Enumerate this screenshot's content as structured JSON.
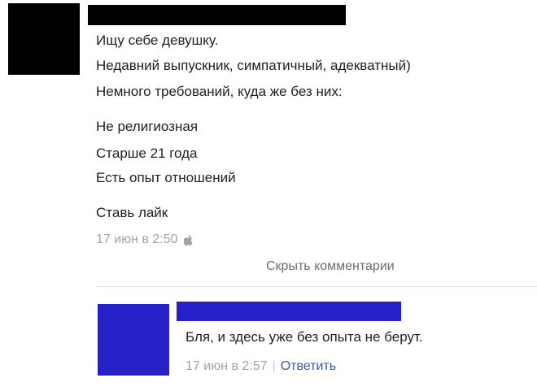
{
  "post": {
    "lines": [
      "Ищу себе девушку.",
      "Недавний выпускник, симпатичный, адекватный)",
      "Немного требований, куда же без них:",
      "Не религиозная",
      "Старше 21 года",
      "Есть опыт отношений",
      "Ставь лайк"
    ],
    "timestamp": "17 июн в 2:50",
    "device_icon": "apple-icon"
  },
  "comments_toggle": "Скрыть комментарии",
  "comment": {
    "text": "Бля, и здесь уже без опыта не берут.",
    "timestamp": "17 июн в 2:57",
    "separator": "|",
    "reply_label": "Ответить"
  },
  "colors": {
    "redaction_black": "#000000",
    "redaction_blue": "#2621c7",
    "link": "#3b5f9a",
    "meta_gray": "#a3a3a3"
  }
}
